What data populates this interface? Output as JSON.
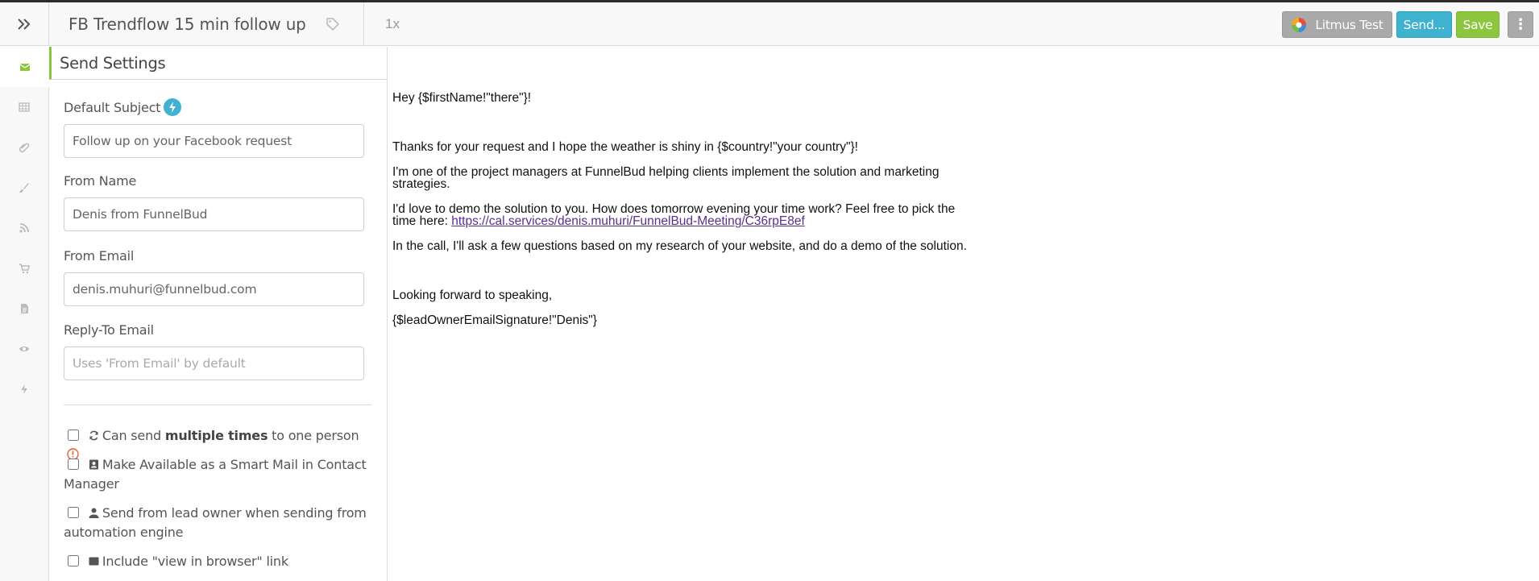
{
  "header": {
    "title": "FB Trendflow 15 min follow up",
    "count": "1x",
    "buttons": {
      "litmus": "Litmus Test",
      "send": "Send...",
      "save": "Save",
      "more": "⋮"
    }
  },
  "rail": {
    "items": [
      "envelope-icon",
      "table-icon",
      "paperclip-icon",
      "brush-icon",
      "rss-icon",
      "cart-icon",
      "document-icon",
      "eye-icon",
      "bolt-icon"
    ],
    "active": "envelope-icon"
  },
  "panel": {
    "title": "Send Settings",
    "subject": {
      "label": "Default Subject",
      "value": "Follow up on your Facebook request"
    },
    "from_name": {
      "label": "From Name",
      "value": "Denis from FunnelBud"
    },
    "from_email": {
      "label": "From Email",
      "value": "denis.muhuri@funnelbud.com"
    },
    "reply_to": {
      "label": "Reply-To Email",
      "placeholder": "Uses 'From Email' by default"
    },
    "checks": {
      "multiple_pre": "Can send ",
      "multiple_bold": "multiple times",
      "multiple_post": " to one person",
      "smart_mail": "Make Available as a Smart Mail in Contact Manager",
      "lead_owner": "Send from lead owner when sending from automation engine",
      "view_browser": "Include \"view in browser\" link"
    }
  },
  "email": {
    "greeting": "Hey {$firstName!\"there\"}!",
    "line1": "Thanks for your request and I hope the weather is shiny in  {$country!\"your country\"}!",
    "line2": "I'm one of the project managers at FunnelBud helping clients implement the solution and marketing strategies.",
    "line3_text": "I'd love to demo the solution to you. How does tomorrow evening your time work? Feel free to pick the time here: ",
    "line3_link": "https://cal.services/denis.muhuri/FunnelBud-Meeting/C36rpE8ef",
    "line4": "In the call, I'll ask a few questions based on my research of your website, and do a demo of the solution.",
    "closing": "Looking forward to speaking,",
    "signature": "{$leadOwnerEmailSignature!\"Denis\"}"
  },
  "colors": {
    "accent_green": "#8cc63f",
    "send_blue": "#3fb2d0",
    "litmus_grey": "#a9a9a9",
    "link_purple": "#5a2d91"
  }
}
